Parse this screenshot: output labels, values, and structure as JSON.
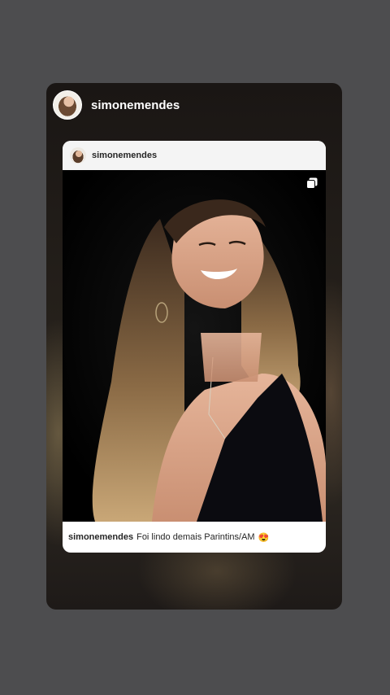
{
  "story": {
    "username": "simonemendes"
  },
  "post": {
    "username": "simonemendes",
    "caption": {
      "username": "simonemendes",
      "text": "Foi lindo demais Parintins/AM",
      "emoji": "😍"
    }
  },
  "icons": {
    "story_avatar": "avatar",
    "post_avatar": "avatar",
    "multiple_posts": "carousel-icon"
  }
}
